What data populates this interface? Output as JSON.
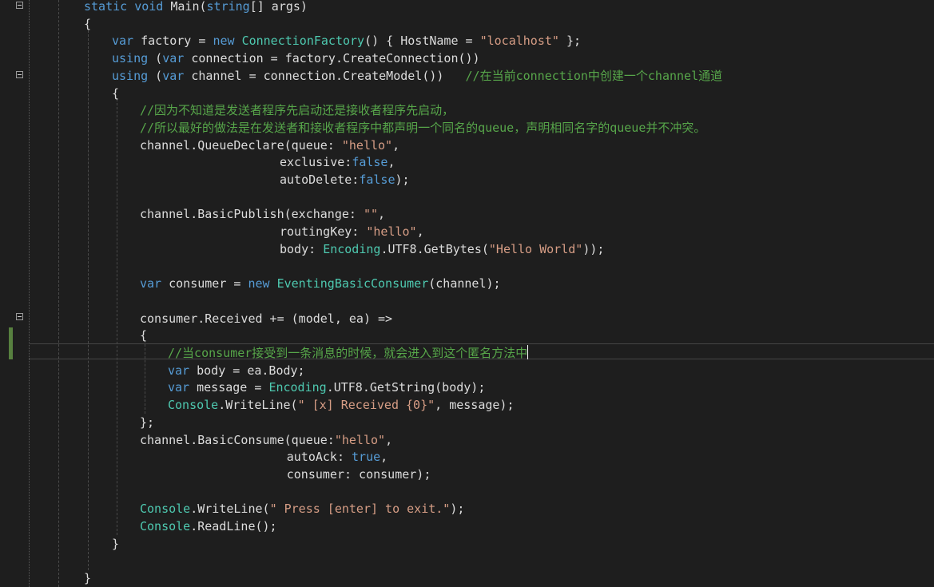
{
  "editor": {
    "language": "C#",
    "theme": "dark",
    "colors": {
      "background": "#1e1e1e",
      "keyword": "#569cd6",
      "type": "#4ec9b0",
      "string": "#d69d85",
      "comment": "#57a64a",
      "plain": "#dcdcdc",
      "changed_line_marker": "#57803f"
    },
    "fold_icons": [
      "fold-minus-icon",
      "fold-minus-icon",
      "fold-minus-icon"
    ],
    "lines": [
      {
        "indent": 0,
        "tokens": [
          {
            "t": "kw",
            "v": "static"
          },
          {
            "t": "pl",
            "v": " "
          },
          {
            "t": "kw",
            "v": "void"
          },
          {
            "t": "pl",
            "v": " Main("
          },
          {
            "t": "kw",
            "v": "string"
          },
          {
            "t": "pl",
            "v": "[] args)"
          }
        ]
      },
      {
        "indent": 0,
        "tokens": [
          {
            "t": "pl",
            "v": "{"
          }
        ]
      },
      {
        "indent": 1,
        "tokens": [
          {
            "t": "kw",
            "v": "var"
          },
          {
            "t": "pl",
            "v": " factory = "
          },
          {
            "t": "kw",
            "v": "new"
          },
          {
            "t": "pl",
            "v": " "
          },
          {
            "t": "ty",
            "v": "ConnectionFactory"
          },
          {
            "t": "pl",
            "v": "() { HostName = "
          },
          {
            "t": "st",
            "v": "\"localhost\""
          },
          {
            "t": "pl",
            "v": " };"
          }
        ]
      },
      {
        "indent": 1,
        "tokens": [
          {
            "t": "kw",
            "v": "using"
          },
          {
            "t": "pl",
            "v": " ("
          },
          {
            "t": "kw",
            "v": "var"
          },
          {
            "t": "pl",
            "v": " connection = factory.CreateConnection())"
          }
        ]
      },
      {
        "indent": 1,
        "tokens": [
          {
            "t": "kw",
            "v": "using"
          },
          {
            "t": "pl",
            "v": " ("
          },
          {
            "t": "kw",
            "v": "var"
          },
          {
            "t": "pl",
            "v": " channel = connection.CreateModel())   "
          },
          {
            "t": "cm",
            "v": "//在当前connection中创建一个channel通道"
          }
        ]
      },
      {
        "indent": 1,
        "tokens": [
          {
            "t": "pl",
            "v": "{"
          }
        ]
      },
      {
        "indent": 2,
        "tokens": [
          {
            "t": "cm",
            "v": "//因为不知道是发送者程序先启动还是接收者程序先启动，"
          }
        ]
      },
      {
        "indent": 2,
        "tokens": [
          {
            "t": "cm",
            "v": "//所以最好的做法是在发送者和接收者程序中都声明一个同名的queue，声明相同名字的queue并不冲突。"
          }
        ]
      },
      {
        "indent": 2,
        "tokens": [
          {
            "t": "pl",
            "v": "channel.QueueDeclare(queue: "
          },
          {
            "t": "st",
            "v": "\"hello\""
          },
          {
            "t": "pl",
            "v": ","
          }
        ]
      },
      {
        "indent": 7,
        "tokens": [
          {
            "t": "pl",
            "v": "exclusive:"
          },
          {
            "t": "kw",
            "v": "false"
          },
          {
            "t": "pl",
            "v": ","
          }
        ]
      },
      {
        "indent": 7,
        "tokens": [
          {
            "t": "pl",
            "v": "autoDelete:"
          },
          {
            "t": "kw",
            "v": "false"
          },
          {
            "t": "pl",
            "v": ");"
          }
        ]
      },
      {
        "indent": 0,
        "tokens": []
      },
      {
        "indent": 2,
        "tokens": [
          {
            "t": "pl",
            "v": "channel.BasicPublish(exchange: "
          },
          {
            "t": "st",
            "v": "\"\""
          },
          {
            "t": "pl",
            "v": ","
          }
        ]
      },
      {
        "indent": 7,
        "tokens": [
          {
            "t": "pl",
            "v": "routingKey: "
          },
          {
            "t": "st",
            "v": "\"hello\""
          },
          {
            "t": "pl",
            "v": ","
          }
        ]
      },
      {
        "indent": 7,
        "tokens": [
          {
            "t": "pl",
            "v": "body: "
          },
          {
            "t": "ty",
            "v": "Encoding"
          },
          {
            "t": "pl",
            "v": ".UTF8.GetBytes("
          },
          {
            "t": "st",
            "v": "\"Hello World\""
          },
          {
            "t": "pl",
            "v": "));"
          }
        ]
      },
      {
        "indent": 0,
        "tokens": []
      },
      {
        "indent": 2,
        "tokens": [
          {
            "t": "kw",
            "v": "var"
          },
          {
            "t": "pl",
            "v": " consumer = "
          },
          {
            "t": "kw",
            "v": "new"
          },
          {
            "t": "pl",
            "v": " "
          },
          {
            "t": "ty",
            "v": "EventingBasicConsumer"
          },
          {
            "t": "pl",
            "v": "(channel);"
          }
        ]
      },
      {
        "indent": 0,
        "tokens": []
      },
      {
        "indent": 2,
        "tokens": [
          {
            "t": "pl",
            "v": "consumer.Received += (model, ea) =>"
          }
        ]
      },
      {
        "indent": 2,
        "tokens": [
          {
            "t": "pl",
            "v": "{"
          }
        ]
      },
      {
        "indent": 3,
        "tokens": [
          {
            "t": "cm",
            "v": "//当consumer接受到一条消息的时候，就会进入到这个匿名方法中"
          }
        ],
        "caret": true
      },
      {
        "indent": 3,
        "tokens": [
          {
            "t": "kw",
            "v": "var"
          },
          {
            "t": "pl",
            "v": " body = ea.Body;"
          }
        ]
      },
      {
        "indent": 3,
        "tokens": [
          {
            "t": "kw",
            "v": "var"
          },
          {
            "t": "pl",
            "v": " message = "
          },
          {
            "t": "ty",
            "v": "Encoding"
          },
          {
            "t": "pl",
            "v": ".UTF8.GetString(body);"
          }
        ]
      },
      {
        "indent": 3,
        "tokens": [
          {
            "t": "ty",
            "v": "Console"
          },
          {
            "t": "pl",
            "v": ".WriteLine("
          },
          {
            "t": "st",
            "v": "\" [x] Received {0}\""
          },
          {
            "t": "pl",
            "v": ", message);"
          }
        ]
      },
      {
        "indent": 2,
        "tokens": [
          {
            "t": "pl",
            "v": "};"
          }
        ]
      },
      {
        "indent": 2,
        "tokens": [
          {
            "t": "pl",
            "v": "channel.BasicConsume(queue:"
          },
          {
            "t": "st",
            "v": "\"hello\""
          },
          {
            "t": "pl",
            "v": ","
          }
        ]
      },
      {
        "indent": 7.25,
        "tokens": [
          {
            "t": "pl",
            "v": "autoAck: "
          },
          {
            "t": "kw",
            "v": "true"
          },
          {
            "t": "pl",
            "v": ","
          }
        ]
      },
      {
        "indent": 7.25,
        "tokens": [
          {
            "t": "pl",
            "v": "consumer: consumer);"
          }
        ]
      },
      {
        "indent": 0,
        "tokens": []
      },
      {
        "indent": 2,
        "tokens": [
          {
            "t": "ty",
            "v": "Console"
          },
          {
            "t": "pl",
            "v": ".WriteLine("
          },
          {
            "t": "st",
            "v": "\" Press [enter] to exit.\""
          },
          {
            "t": "pl",
            "v": ");"
          }
        ]
      },
      {
        "indent": 2,
        "tokens": [
          {
            "t": "ty",
            "v": "Console"
          },
          {
            "t": "pl",
            "v": ".ReadLine();"
          }
        ]
      },
      {
        "indent": 1,
        "tokens": [
          {
            "t": "pl",
            "v": "}"
          }
        ]
      },
      {
        "indent": 0,
        "tokens": []
      },
      {
        "indent": 0,
        "tokens": [
          {
            "t": "pl",
            "v": "}"
          }
        ]
      }
    ]
  }
}
